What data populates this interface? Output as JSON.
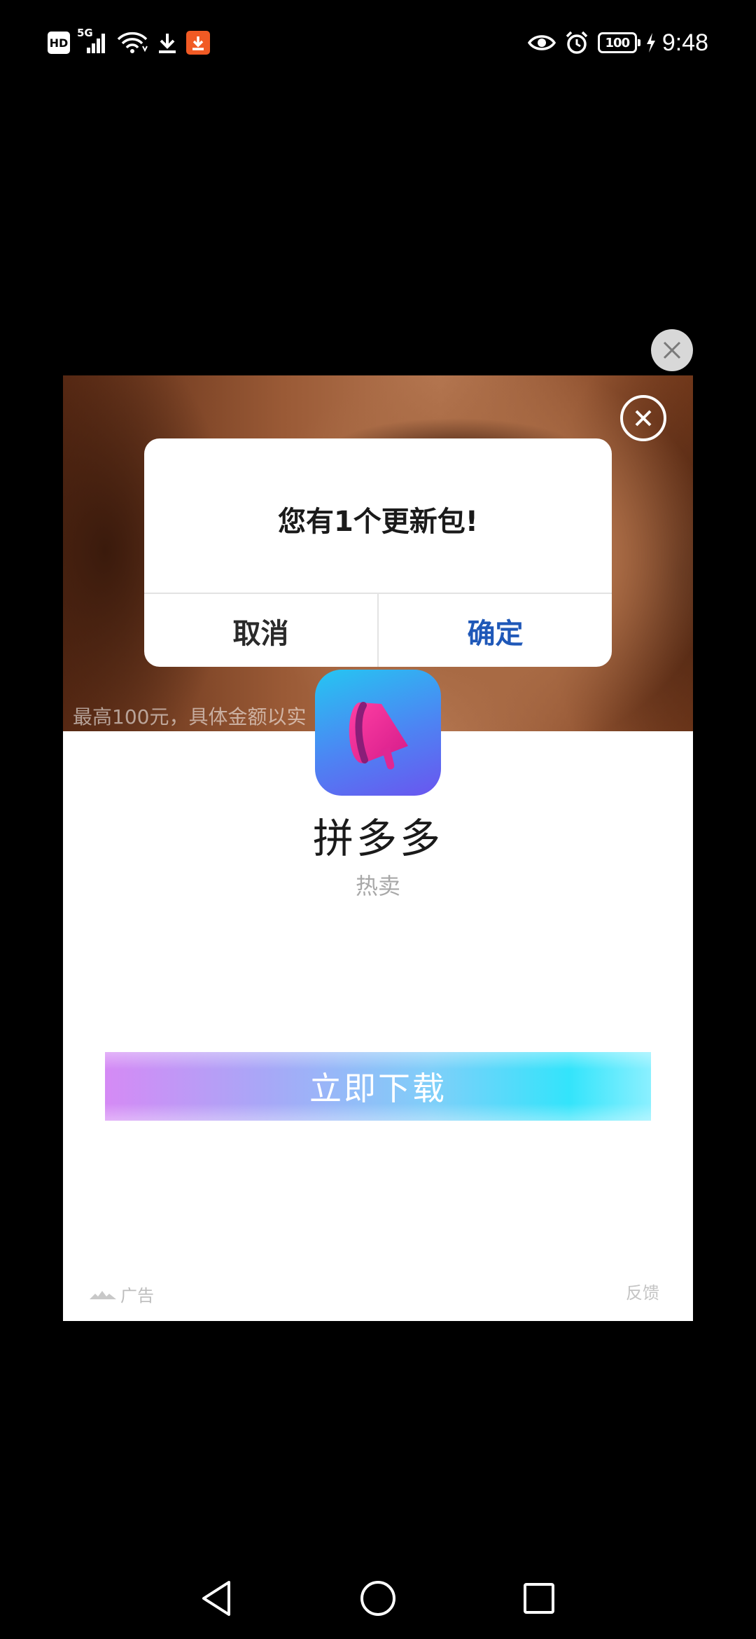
{
  "status_bar": {
    "hd": "HD",
    "network": "5G",
    "battery": "100",
    "time": "9:48"
  },
  "ad": {
    "caption": "最高100元，具体金额以实",
    "app_name": "拼多多",
    "app_tag": "热卖",
    "download_label": "立即下载",
    "ad_label": "广告",
    "feedback_label": "反馈"
  },
  "dialog": {
    "message": "您有1个更新包!",
    "cancel_label": "取消",
    "confirm_label": "确定",
    "confirm_color": "#1f58b8"
  },
  "icons": {
    "outer_close": "close-icon",
    "inner_close": "close-circle-icon",
    "app_icon": "megaphone-icon",
    "nav_back": "back-triangle-icon",
    "nav_home": "home-circle-icon",
    "nav_recents": "recents-square-icon"
  }
}
